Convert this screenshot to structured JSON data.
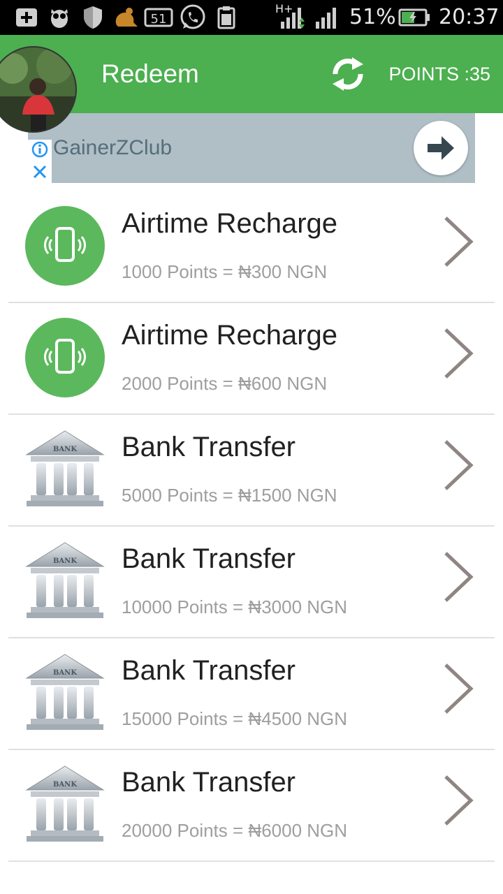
{
  "status_bar": {
    "signal_type": "H+",
    "battery_percent": "51%",
    "time": "20:37",
    "notification_count": "51",
    "icons": [
      "plus-icon",
      "owl-icon",
      "shield-icon",
      "uc-browser-icon",
      "notification-count-icon",
      "whatsapp-icon",
      "clipboard-icon",
      "signal-icon",
      "battery-icon"
    ]
  },
  "header": {
    "title": "Redeem",
    "points_label": "POINTS :35",
    "refresh_icon": "refresh-icon",
    "color": "#4caf50"
  },
  "ad": {
    "title": "GainerZClub",
    "info_icon": "info-icon",
    "close_icon": "close-icon",
    "action_icon": "arrow-right-icon",
    "background": "#b0bec5"
  },
  "redeem_options": [
    {
      "title": "Airtime Recharge",
      "subtitle": "1000 Points = ₦300 NGN",
      "icon": "phone-icon"
    },
    {
      "title": "Airtime Recharge",
      "subtitle": "2000 Points = ₦600 NGN",
      "icon": "phone-icon"
    },
    {
      "title": "Bank Transfer",
      "subtitle": "5000 Points = ₦1500 NGN",
      "icon": "bank-icon"
    },
    {
      "title": "Bank Transfer",
      "subtitle": "10000 Points = ₦3000 NGN",
      "icon": "bank-icon"
    },
    {
      "title": "Bank Transfer",
      "subtitle": "15000 Points = ₦4500 NGN",
      "icon": "bank-icon"
    },
    {
      "title": "Bank Transfer",
      "subtitle": "20000 Points = ₦6000 NGN",
      "icon": "bank-icon"
    }
  ],
  "bank_sign_text": "BANK"
}
